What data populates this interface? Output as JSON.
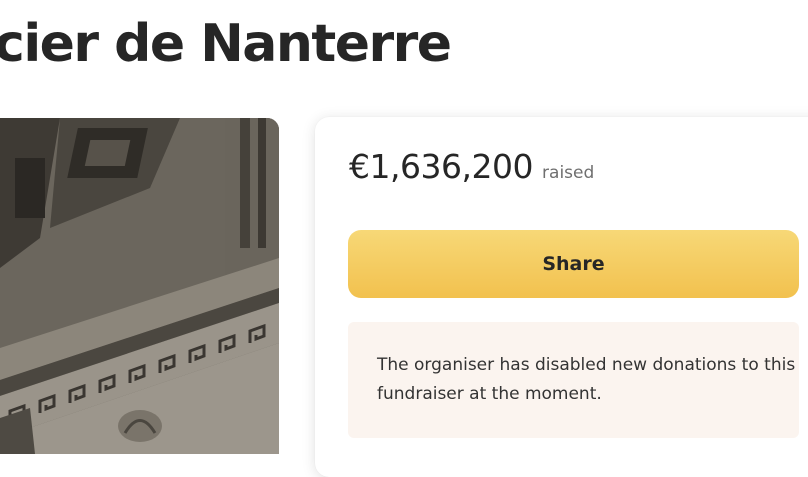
{
  "page": {
    "title": "cier de Nanterre"
  },
  "hero": {
    "image_description": "photo"
  },
  "donation": {
    "amount": "€1,636,200",
    "raised_label": "raised",
    "share_label": "Share",
    "notice": "The organiser has disabled new donations to this fundraiser at the moment."
  },
  "colors": {
    "share_button": "#f2c14e",
    "notice_background": "#fbf4ef",
    "text": "#262626"
  }
}
